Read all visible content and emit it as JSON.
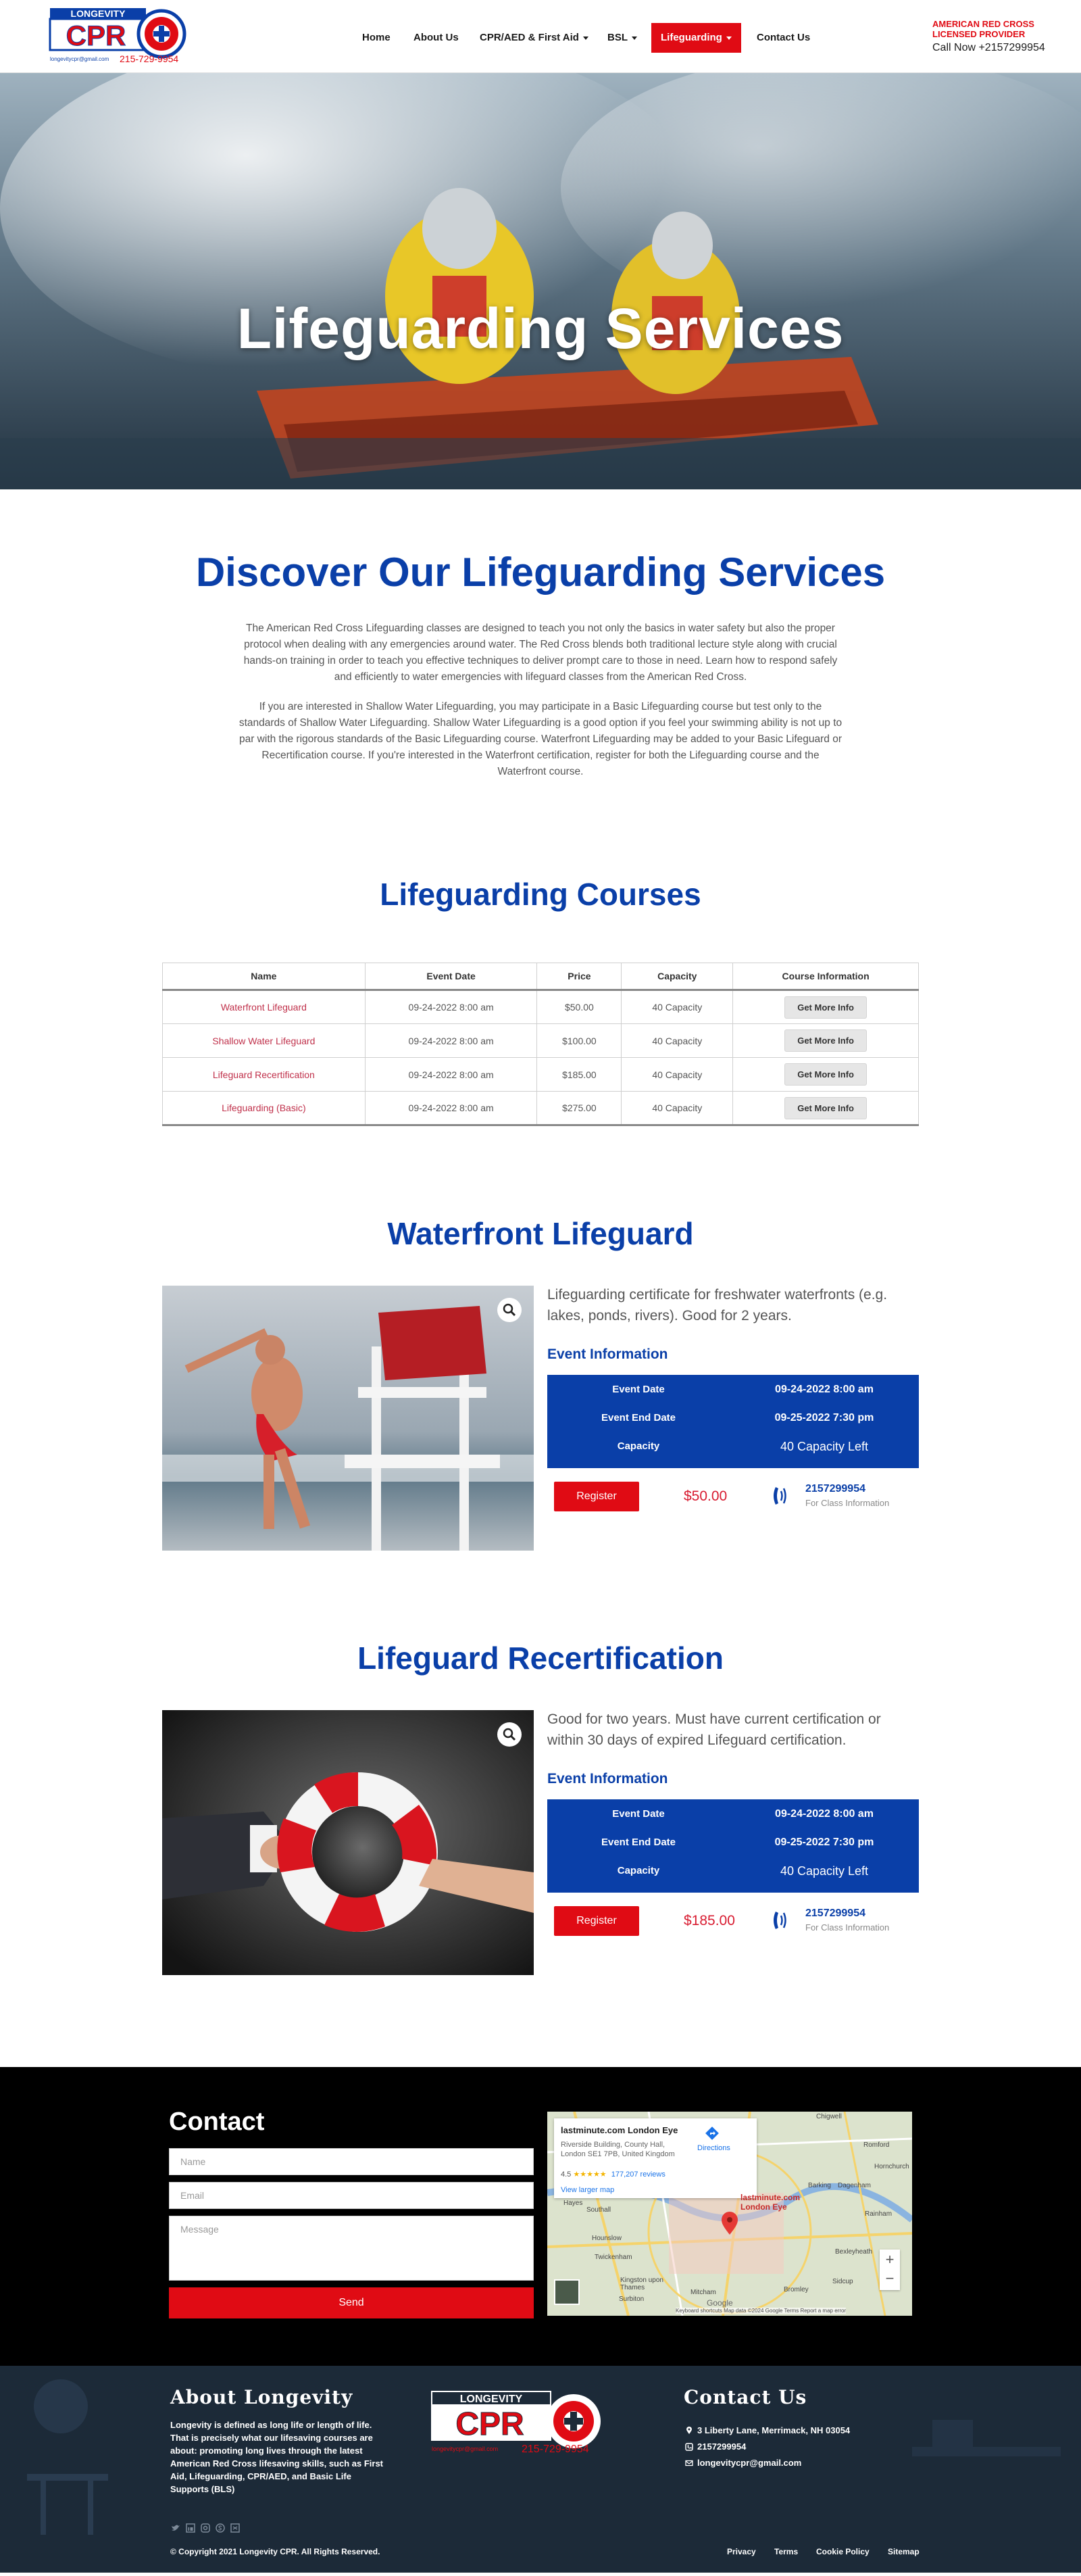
{
  "header": {
    "logo": {
      "word_top": "LONGEVITY",
      "word_main": "CPR",
      "email": "longevitycpr@gmail.com",
      "phone": "215-729-9954"
    },
    "nav": [
      {
        "label": "Home"
      },
      {
        "label": "About Us"
      },
      {
        "label": "CPR/AED & First Aid"
      },
      {
        "label": "BSL"
      },
      {
        "label": "Lifeguarding"
      },
      {
        "label": "Contact Us"
      }
    ],
    "arc_line1": "AMERICAN RED CROSS",
    "arc_line2": "LICENSED PROVIDER",
    "call_now": "Call Now +2157299954"
  },
  "hero": {
    "title": "Lifeguarding Services"
  },
  "discover": {
    "title": "Discover Our Lifeguarding Services",
    "p1": "The American Red Cross Lifeguarding classes are designed to teach you not only the basics in water safety but also the proper protocol when dealing with any emergencies around water. The Red Cross blends both traditional lecture style along with crucial hands-on training in order to teach you effective techniques to deliver prompt care to those in need. Learn how to respond safely and efficiently to water emergencies with lifeguard classes from the American Red Cross.",
    "p2": "If you are interested in Shallow Water Lifeguarding, you may participate in a Basic Lifeguarding course but test only to the standards of Shallow Water Lifeguarding. Shallow Water Lifeguarding is a good option if you feel your swimming ability is not up to par with the rigorous standards of the Basic Lifeguarding course. Waterfront Lifeguarding may be added to your Basic Lifeguard or Recertification course. If you're interested in the Waterfront certification, register for both the Lifeguarding course and the Waterfront course."
  },
  "courses": {
    "title": "Lifeguarding Courses",
    "headers": [
      "Name",
      "Event Date",
      "Price",
      "Capacity",
      "Course Information"
    ],
    "rows": [
      {
        "name": "Waterfront Lifeguard",
        "date": "09-24-2022 8:00 am",
        "price": "$50.00",
        "capacity": "40 Capacity",
        "button": "Get More Info"
      },
      {
        "name": "Shallow Water Lifeguard",
        "date": "09-24-2022 8:00 am",
        "price": "$100.00",
        "capacity": "40 Capacity",
        "button": "Get More Info"
      },
      {
        "name": "Lifeguard Recertification",
        "date": "09-24-2022 8:00 am",
        "price": "$185.00",
        "capacity": "40 Capacity",
        "button": "Get More Info"
      },
      {
        "name": "Lifeguarding (Basic)",
        "date": "09-24-2022 8:00 am",
        "price": "$275.00",
        "capacity": "40 Capacity",
        "button": "Get More Info"
      }
    ]
  },
  "waterfront": {
    "title": "Waterfront Lifeguard",
    "desc": "Lifeguarding certificate for freshwater waterfronts (e.g. lakes, ponds, rivers). Good for 2 years.",
    "event_title": "Event Information",
    "labels": [
      "Event Date",
      "Event End Date",
      "Capacity"
    ],
    "values": [
      "09-24-2022 8:00 am",
      "09-25-2022 7:30 pm",
      "40 Capacity Left"
    ],
    "register": "Register",
    "price": "$50.00",
    "phone": "2157299954",
    "phone_sub": "For Class Information"
  },
  "recert": {
    "title": "Lifeguard Recertification",
    "desc": "Good for two years. Must have current certification or within 30 days of expired Lifeguard certification.",
    "event_title": "Event Information",
    "labels": [
      "Event Date",
      "Event End Date",
      "Capacity"
    ],
    "values": [
      "09-24-2022 8:00 am",
      "09-25-2022 7:30 pm",
      "40 Capacity Left"
    ],
    "register": "Register",
    "price": "$185.00",
    "phone": "2157299954",
    "phone_sub": "For Class Information"
  },
  "contact": {
    "title": "Contact",
    "name_ph": "Name",
    "email_ph": "Email",
    "message_ph": "Message",
    "send": "Send",
    "map": {
      "place": "lastminute.com London Eye",
      "address": "Riverside Building, County Hall, London SE1 7PB, United Kingdom",
      "rating": "4.5",
      "reviews": "177,207 reviews",
      "directions": "Directions",
      "larger": "View larger map",
      "pin_label": "lastminute.com London Eye",
      "footer_text": "Keyboard shortcuts   Map data ©2024 Google   Terms   Report a map error",
      "google": "Google",
      "towns": [
        "Chigwell",
        "Romford",
        "Hornchurch",
        "Barking",
        "Dagenham",
        "Rainham",
        "Bexleyheath",
        "Sidcup",
        "Bromley",
        "Mitcham",
        "Kingston upon Thames",
        "Twickenham",
        "Hounslow",
        "Hayes",
        "Southall",
        "Surbiton"
      ]
    }
  },
  "footer": {
    "about_title": "About Longevity",
    "about_text": "Longevity  is defined as long life or length of life. That is precisely what our lifesaving courses are about: promoting long lives through the latest American Red Cross lifesaving skills, such as First Aid, Lifeguarding, CPR/AED, and Basic Life Supports (BLS)",
    "contact_title": "Contact Us",
    "address": "3 Liberty Lane, Merrimack, NH 03054",
    "phone": "2157299954",
    "email": "longevitycpr@gmail.com",
    "copyright": "© Copyright 2021 Longevity CPR. All Rights Reserved.",
    "links": [
      "Privacy",
      "Terms",
      "Cookie Policy",
      "Sitemap"
    ]
  },
  "colors": {
    "brand_blue": "#0a3fa8",
    "brand_red": "#e00b14",
    "footer_bg": "#1c2a38"
  }
}
